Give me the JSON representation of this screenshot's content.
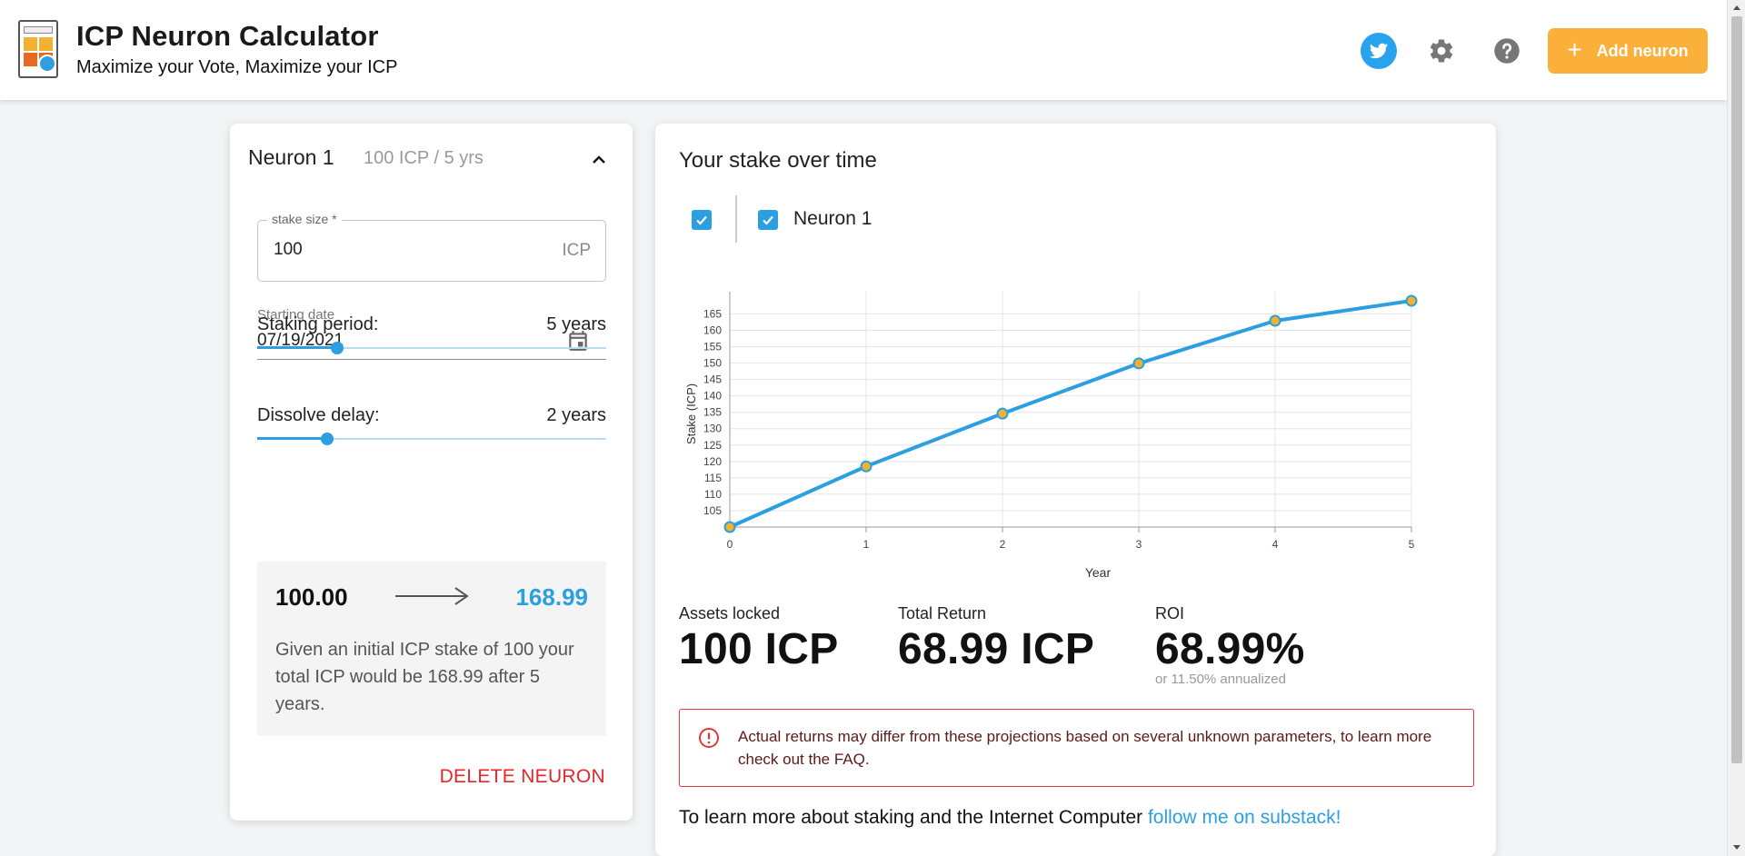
{
  "header": {
    "title": "ICP Neuron Calculator",
    "subtitle": "Maximize your Vote, Maximize your ICP",
    "add_button_label": "Add neuron",
    "brand_color": "#fbb03b",
    "icons": [
      "twitter-icon",
      "gear-icon",
      "help-icon",
      "plus-icon"
    ]
  },
  "neuron": {
    "title": "Neuron 1",
    "summary": "100 ICP / 5 yrs",
    "stake_label": "stake size *",
    "stake_value": "100",
    "stake_unit": "ICP",
    "date_label": "Starting date",
    "date_value": "07/19/2021",
    "period_label": "Staking period:",
    "period_value": "5 years",
    "period_slider_fraction": 0.23,
    "dissolve_label": "Dissolve delay:",
    "dissolve_value": "2 years",
    "dissolve_slider_fraction": 0.2,
    "result_from": "100.00",
    "result_to": "168.99",
    "result_text": "Given an initial ICP stake of 100 your total ICP would be 168.99 after 5 years.",
    "delete_label": "DELETE NEURON"
  },
  "stake": {
    "title": "Your stake over time",
    "legend_label": "Neuron 1",
    "assets_label": "Assets locked",
    "assets_value": "100 ICP",
    "return_label": "Total Return",
    "return_value": "68.99 ICP",
    "roi_label": "ROI",
    "roi_value": "68.99%",
    "roi_note": "or 11.50% annualized",
    "warning": "Actual returns may differ from these projections based on several unknown parameters, to learn more check out the FAQ.",
    "learn_prefix": "To learn more about staking and the Internet Computer ",
    "learn_link": "follow me on substack!"
  },
  "chart_data": {
    "type": "line",
    "x": [
      0,
      1,
      2,
      3,
      4,
      5
    ],
    "series": [
      {
        "name": "Neuron 1",
        "values": [
          100,
          118.5,
          134.6,
          149.9,
          162.9,
          168.99
        ]
      }
    ],
    "xlabel": "Year",
    "ylabel": "Stake (ICP)",
    "yticks": [
      105,
      110,
      115,
      120,
      125,
      130,
      135,
      140,
      145,
      150,
      155,
      160,
      165
    ],
    "xlim": [
      0,
      5
    ],
    "ylim": [
      100,
      169
    ],
    "grid": true,
    "line_color": "#2b9fe0",
    "point_color": "#f2b230"
  }
}
